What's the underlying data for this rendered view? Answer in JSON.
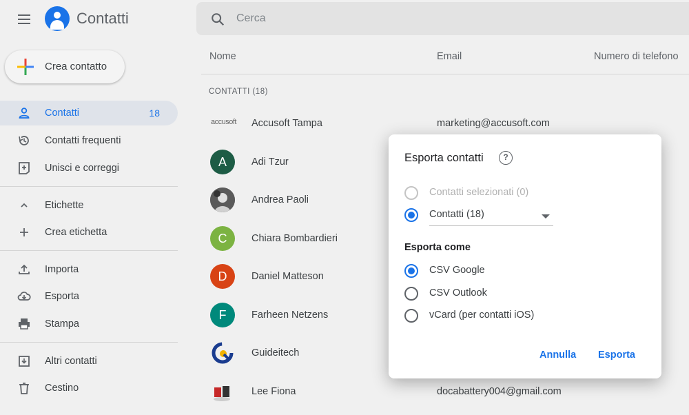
{
  "app": {
    "title": "Contatti"
  },
  "search": {
    "placeholder": "Cerca"
  },
  "sidebar": {
    "create_label": "Crea contatto",
    "items": [
      {
        "label": "Contatti",
        "count": "18",
        "icon": "person-icon"
      },
      {
        "label": "Contatti frequenti",
        "icon": "history-icon"
      },
      {
        "label": "Unisci e correggi",
        "icon": "merge-icon"
      },
      {
        "label": "Etichette",
        "icon": "chevron-up-icon"
      },
      {
        "label": "Crea etichetta",
        "icon": "plus-icon"
      },
      {
        "label": "Importa",
        "icon": "upload-icon"
      },
      {
        "label": "Esporta",
        "icon": "cloud-download-icon"
      },
      {
        "label": "Stampa",
        "icon": "printer-icon"
      },
      {
        "label": "Altri contatti",
        "icon": "archive-icon"
      },
      {
        "label": "Cestino",
        "icon": "trash-icon"
      }
    ]
  },
  "list": {
    "columns": {
      "name": "Nome",
      "email": "Email",
      "phone": "Numero di telefono"
    },
    "section_label": "CONTATTI (18)",
    "rows": [
      {
        "name": "Accusoft Tampa",
        "email": "marketing@accusoft.com",
        "avatar_text": "accusoft",
        "avatar_color": "#ffffff"
      },
      {
        "name": "Adi Tzur",
        "email": "",
        "avatar_text": "A",
        "avatar_color": "#1d5c45"
      },
      {
        "name": "Andrea Paoli",
        "email": "",
        "avatar_text": "",
        "avatar_color": "#555555"
      },
      {
        "name": "Chiara Bombardieri",
        "email": "",
        "avatar_text": "C",
        "avatar_color": "#7cb342"
      },
      {
        "name": "Daniel Matteson",
        "email": "",
        "avatar_text": "D",
        "avatar_color": "#d84315"
      },
      {
        "name": "Farheen Netzens",
        "email": "",
        "avatar_text": "F",
        "avatar_color": "#00897b"
      },
      {
        "name": "Guideitech",
        "email": "",
        "avatar_text": "",
        "avatar_color": "#ffffff"
      },
      {
        "name": "Lee Fiona",
        "email": "docabattery004@gmail.com",
        "avatar_text": "",
        "avatar_color": "#ffffff"
      }
    ]
  },
  "dialog": {
    "title": "Esporta contatti",
    "help": "?",
    "scope_options": [
      {
        "label": "Contatti selezionati (0)",
        "state": "disabled"
      },
      {
        "label": "Contatti (18)",
        "state": "checked"
      }
    ],
    "format_heading": "Esporta come",
    "format_options": [
      {
        "label": "CSV Google",
        "state": "checked"
      },
      {
        "label": "CSV Outlook",
        "state": "unchecked"
      },
      {
        "label": "vCard (per contatti iOS)",
        "state": "unchecked"
      }
    ],
    "cancel_label": "Annulla",
    "export_label": "Esporta"
  },
  "colors": {
    "accent": "#1a73e8",
    "active_bg": "#dfe3ea"
  }
}
